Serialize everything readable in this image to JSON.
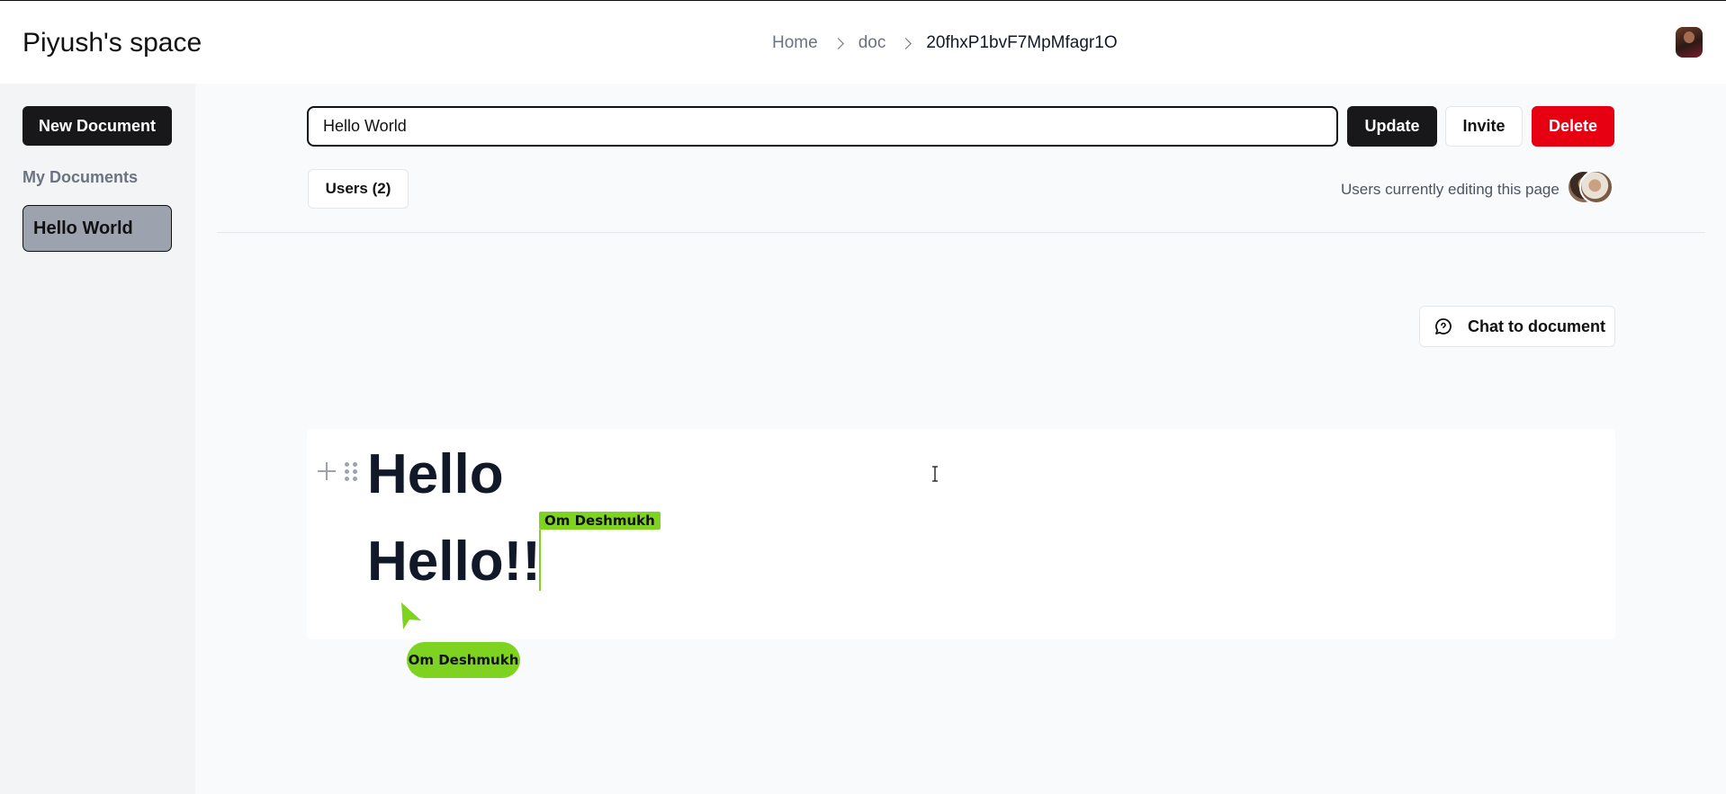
{
  "header": {
    "title": "Piyush's space",
    "breadcrumb": [
      "Home",
      "doc",
      "20fhxP1bvF7MpMfagr1O"
    ]
  },
  "sidebar": {
    "new_document_label": "New Document",
    "section_label": "My Documents",
    "documents": [
      {
        "label": "Hello World",
        "selected": true
      }
    ]
  },
  "toolbar": {
    "title_value": "Hello World",
    "update_label": "Update",
    "invite_label": "Invite",
    "delete_label": "Delete",
    "delete_color": "#e60012",
    "users_label": "Users (2)",
    "editing_label": "Users currently editing this page"
  },
  "chat": {
    "label": "Chat to document",
    "icon": "chat-bubble-icon"
  },
  "editor": {
    "lines": [
      "Hello",
      "Hello!!"
    ],
    "collaborator_caret_label": "Om Deshmukh",
    "collaborator_pointer_label": "Om Deshmukh",
    "collaborator_color": "#7ed321"
  }
}
